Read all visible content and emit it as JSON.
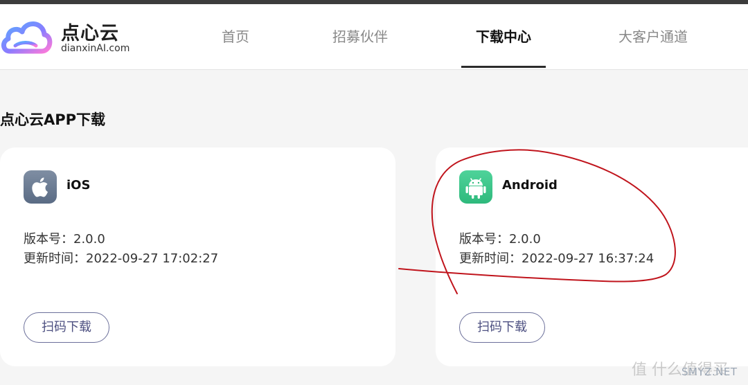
{
  "brand": {
    "name": "点心云",
    "domain": "dianxinAI.com"
  },
  "nav": {
    "items": [
      {
        "label": "首页",
        "active": false
      },
      {
        "label": "招募伙伴",
        "active": false
      },
      {
        "label": "下载中心",
        "active": true
      },
      {
        "label": "大客户通道",
        "active": false
      }
    ]
  },
  "section": {
    "title": "点心云APP下载"
  },
  "cards": [
    {
      "platform": "iOS",
      "icon": "apple-icon",
      "version_line": "版本号：2.0.0",
      "updated_line": "更新时间：2022-09-27 17:02:27",
      "button_label": "扫码下载"
    },
    {
      "platform": "Android",
      "icon": "android-icon",
      "version_line": "版本号：2.0.0",
      "updated_line": "更新时间：2022-09-27 16:37:24",
      "button_label": "扫码下载"
    }
  ],
  "watermark": {
    "site": "SMYZ.NET",
    "overlay": "值 什么值得买"
  },
  "colors": {
    "accent_button": "#4d5081",
    "annotation_red": "#c0141c",
    "android_green": "#3cc98a",
    "ios_gray": "#6b7b93"
  }
}
